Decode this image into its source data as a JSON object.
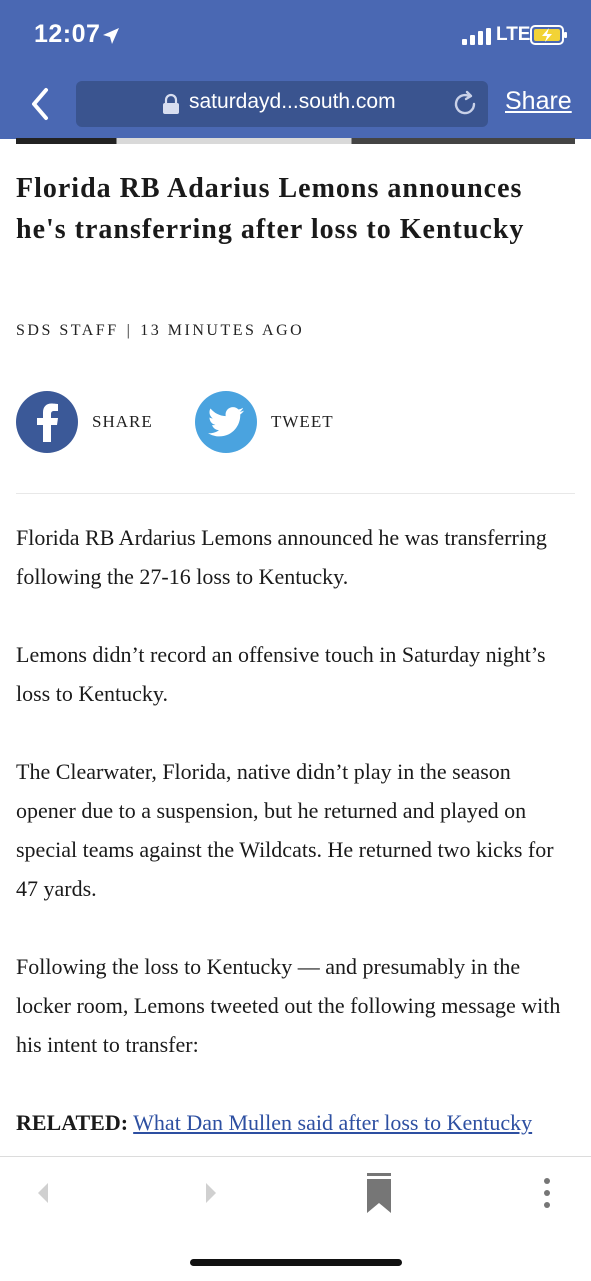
{
  "status_bar": {
    "time": "12:07",
    "network": "LTE"
  },
  "browser": {
    "url": "saturdayd...south.com",
    "share_label": "Share"
  },
  "article": {
    "title": "Florida RB Adarius Lemons announces he's transferring after loss to Kentucky",
    "author": "SDS STAFF",
    "separator": "|",
    "time_ago": "13 MINUTES AGO",
    "share_label": "SHARE",
    "tweet_label": "TWEET",
    "paragraphs": [
      "Florida RB Ardarius Lemons announced he was transferring following the 27-16 loss to Kentucky.",
      "Lemons didn’t record an offensive touch in Saturday night’s loss to Kentucky.",
      "The Clearwater, Florida, native didn’t play in the season opener due to a suspension, but he returned and played on special teams against the Wildcats. He returned two kicks for 47 yards.",
      "Following the loss to Kentucky — and presumably in the locker room, Lemons tweeted out the following message with his intent to transfer:"
    ],
    "related_label": "RELATED:",
    "related_link": "What Dan Mullen said after loss to Kentucky"
  },
  "colors": {
    "header": "#4a68b3",
    "urlbar": "#3a548f",
    "facebook": "#3b5998",
    "twitter": "#4aa3df",
    "link": "#2d4fa1"
  }
}
